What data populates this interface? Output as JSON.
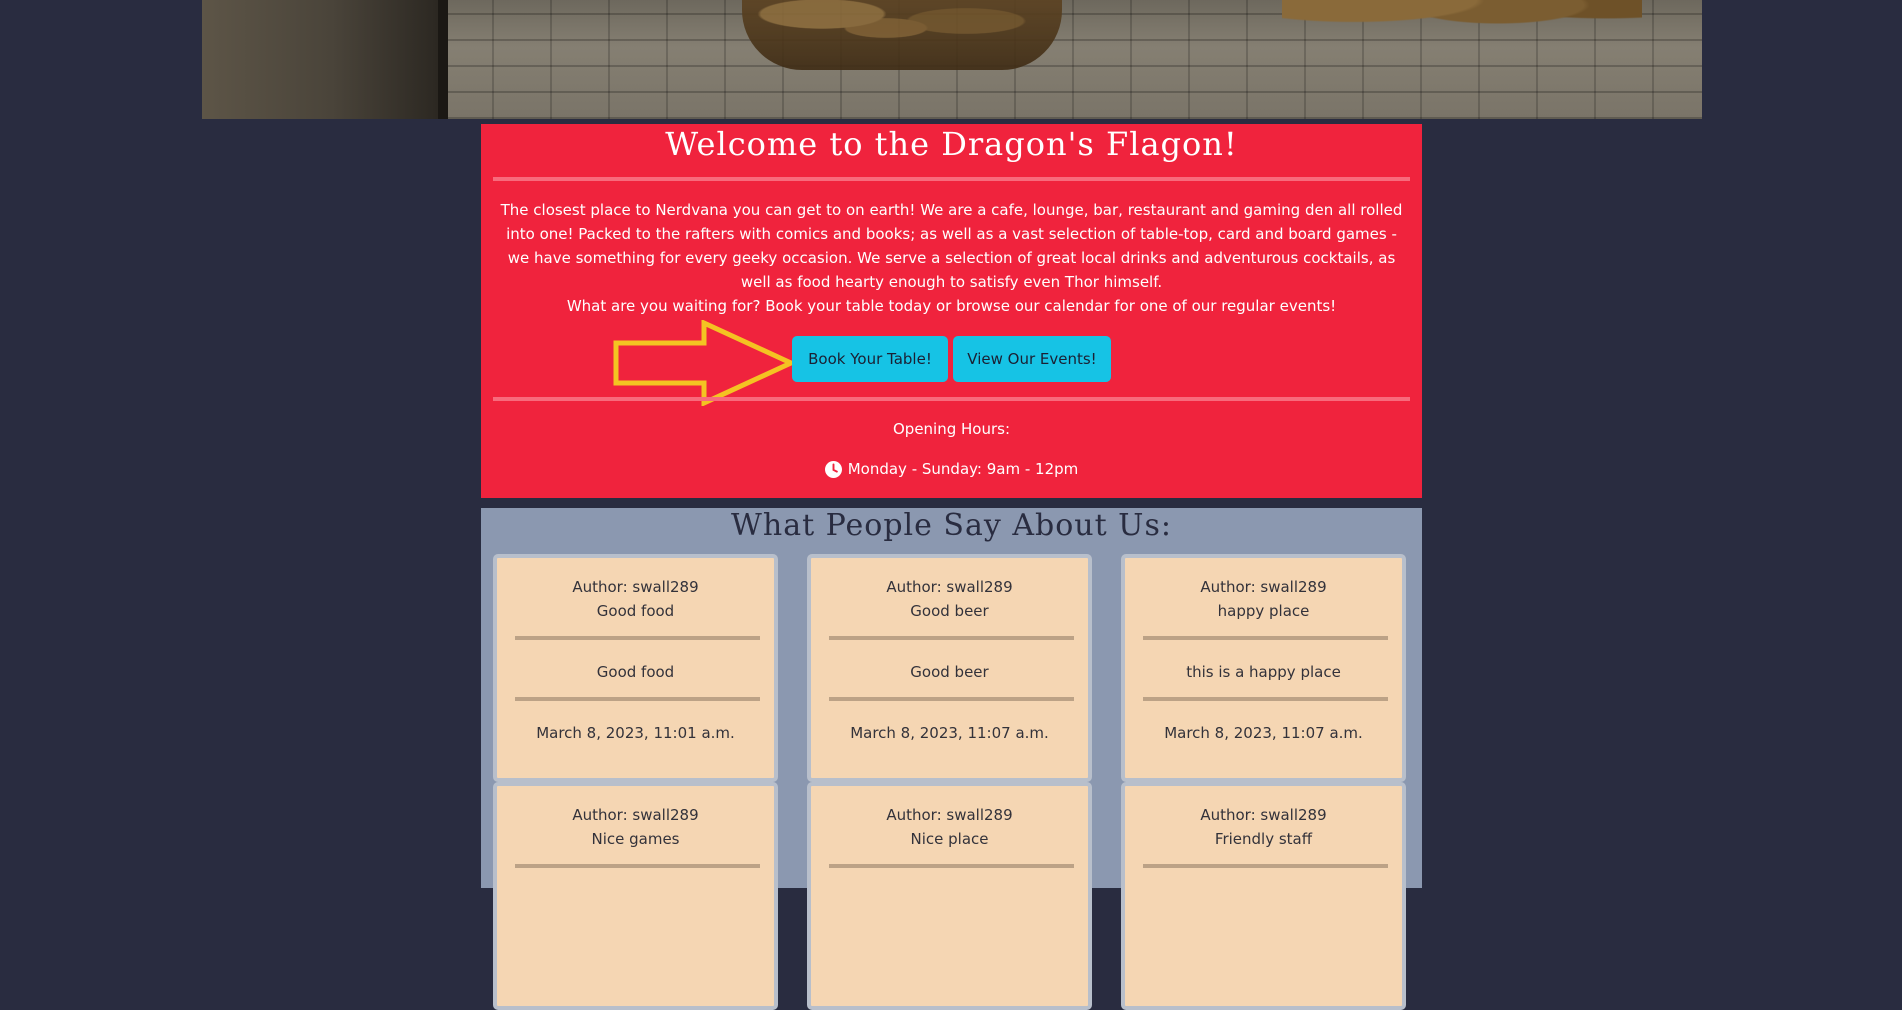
{
  "hero": {
    "image_alt": "tavern interior"
  },
  "welcome": {
    "title": "Welcome to the Dragon's Flagon!",
    "intro": "The closest place to Nerdvana you can get to on earth! We are a cafe, lounge, bar, restaurant and gaming den all rolled into one! Packed to the rafters with comics and books; as well as a vast selection of table-top, card and board games - we have something for every geeky occasion. We serve a selection of great local drinks and adventurous cocktails, as well as food hearty enough to satisfy even Thor himself.",
    "cta_text": "What are you waiting for? Book your table today or browse our calendar for one of our regular events!",
    "book_button": "Book Your Table!",
    "events_button": "View Our Events!",
    "hours_label": "Opening Hours:",
    "hours": "Monday - Sunday: 9am - 12pm",
    "hours_icon": "clock-icon",
    "arrow_icon": "arrow-right-icon"
  },
  "reviews": {
    "heading": "What People Say About Us:",
    "items": [
      {
        "author": "Author: swall289",
        "title": "Good food",
        "body": "Good food",
        "date": "March 8, 2023, 11:01 a.m."
      },
      {
        "author": "Author: swall289",
        "title": "Good beer",
        "body": "Good beer",
        "date": "March 8, 2023, 11:07 a.m."
      },
      {
        "author": "Author: swall289",
        "title": "happy place",
        "body": "this is a happy place",
        "date": "March 8, 2023, 11:07 a.m."
      },
      {
        "author": "Author: swall289",
        "title": "Nice games"
      },
      {
        "author": "Author: swall289",
        "title": "Nice place"
      },
      {
        "author": "Author: swall289",
        "title": "Friendly staff"
      }
    ]
  },
  "colors": {
    "page_bg": "#292c40",
    "welcome_bg": "#f0233d",
    "button_bg": "#16c3e5",
    "reviews_bg": "#8b98b0",
    "card_bg": "#f5d6b3",
    "arrow": "#f4c322"
  }
}
